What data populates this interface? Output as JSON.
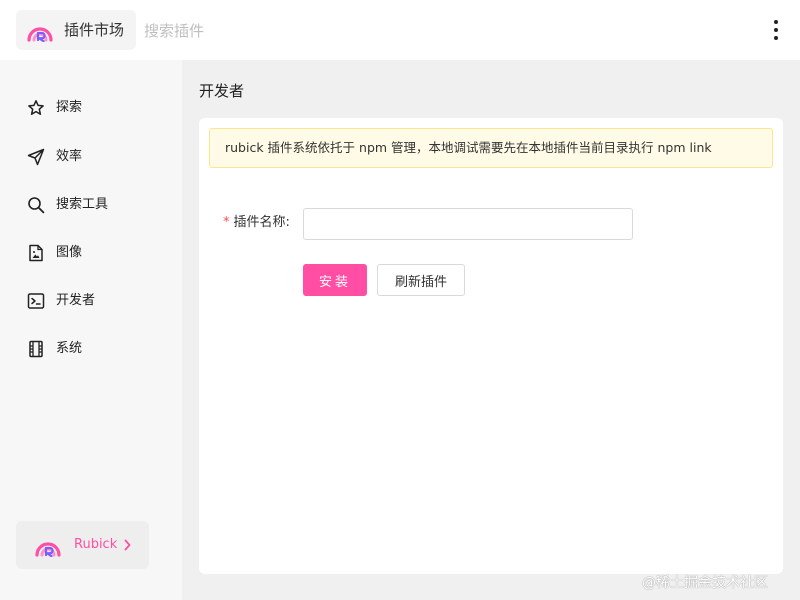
{
  "header": {
    "market_label": "插件市场",
    "search_placeholder": "搜索插件",
    "search_value": "",
    "more_icon": "more-vertical-icon"
  },
  "sidebar": {
    "items": [
      {
        "label": "探索",
        "icon": "star-icon"
      },
      {
        "label": "效率",
        "icon": "send-icon"
      },
      {
        "label": "搜索工具",
        "icon": "search-icon"
      },
      {
        "label": "图像",
        "icon": "image-file-icon"
      },
      {
        "label": "开发者",
        "icon": "terminal-icon"
      },
      {
        "label": "系统",
        "icon": "film-icon"
      }
    ],
    "brand": {
      "label": "Rubick",
      "icon": "rubick-logo-icon"
    }
  },
  "main": {
    "title": "开发者",
    "notice": "rubick 插件系统依托于 npm 管理，本地调试需要先在本地插件当前目录执行 npm link",
    "form": {
      "required_mark": "*",
      "name_label": "插件名称:",
      "name_value": "",
      "install_label": "安装",
      "refresh_label": "刷新插件"
    }
  },
  "colors": {
    "accent": "#ff4ea3",
    "notice_bg": "#fffbe6",
    "notice_border": "#ffe58f",
    "required": "#ff4d4f"
  },
  "watermark": "@稀土掘金技术社区"
}
